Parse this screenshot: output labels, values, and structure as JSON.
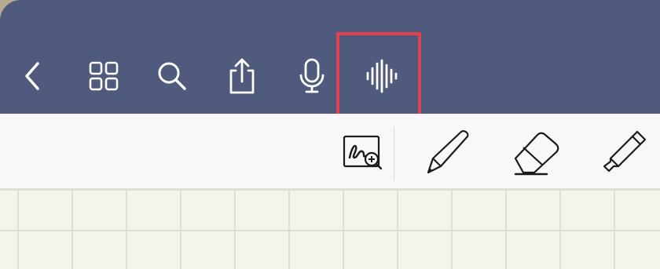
{
  "navbar": {
    "background": "#4f5a7c",
    "icon_color": "#ffffff",
    "buttons": [
      {
        "name": "back-icon"
      },
      {
        "name": "grid-icon"
      },
      {
        "name": "search-icon"
      },
      {
        "name": "share-icon"
      },
      {
        "name": "microphone-icon"
      },
      {
        "name": "audio-waveform-icon"
      }
    ],
    "highlight_color": "#e0414a"
  },
  "toolbar": {
    "tools": [
      {
        "name": "lasso-zoom-icon"
      },
      {
        "name": "pen-icon"
      },
      {
        "name": "eraser-icon"
      },
      {
        "name": "highlighter-icon"
      }
    ],
    "icon_color": "#1a1a1a"
  },
  "canvas": {
    "paper_color": "#f5f4ea",
    "grid_color": "#dfded2",
    "pattern": "grid"
  }
}
